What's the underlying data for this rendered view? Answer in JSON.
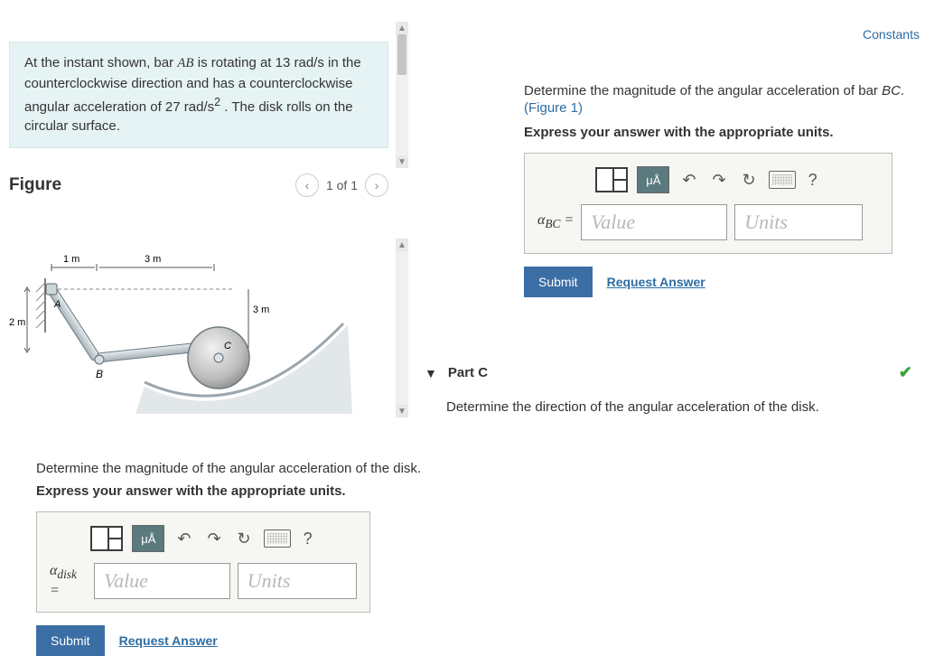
{
  "constants_link": "Constants",
  "problem": {
    "text_html": "At the instant shown, bar <i>AB</i> is rotating at 13 rad/s in the counterclockwise direction and has a counterclockwise angular acceleration of 27 rad/s<sup>2</sup> . The disk rolls on the circular surface."
  },
  "figure": {
    "label": "Figure",
    "pager": "1 of 1",
    "dim_1m": "1 m",
    "dim_3m_top": "3 m",
    "dim_3m_right": "3 m",
    "dim_2m": "2 m",
    "ptA": "A",
    "ptB": "B",
    "ptC": "C"
  },
  "partB": {
    "prompt_html": "Determine the magnitude of the angular acceleration of bar <i>BC</i>.",
    "fig_link": "(Figure 1)",
    "sub": "Express your answer with the appropriate units.",
    "var_label_html": "α<sub>BC</sub> =",
    "value_ph": "Value",
    "units_ph": "Units",
    "xa_label": "μÅ",
    "help": "?",
    "submit": "Submit",
    "request": "Request Answer"
  },
  "partC": {
    "title": "Part C",
    "desc": "Determine the direction of the angular acceleration of the disk."
  },
  "partDisk": {
    "prompt": "Determine the magnitude of the angular acceleration of the disk.",
    "sub": "Express your answer with the appropriate units.",
    "var_label_html": "α<sub>disk</sub> =",
    "value_ph": "Value",
    "units_ph": "Units",
    "xa_label": "μÅ",
    "help": "?",
    "submit": "Submit",
    "request": "Request Answer"
  }
}
